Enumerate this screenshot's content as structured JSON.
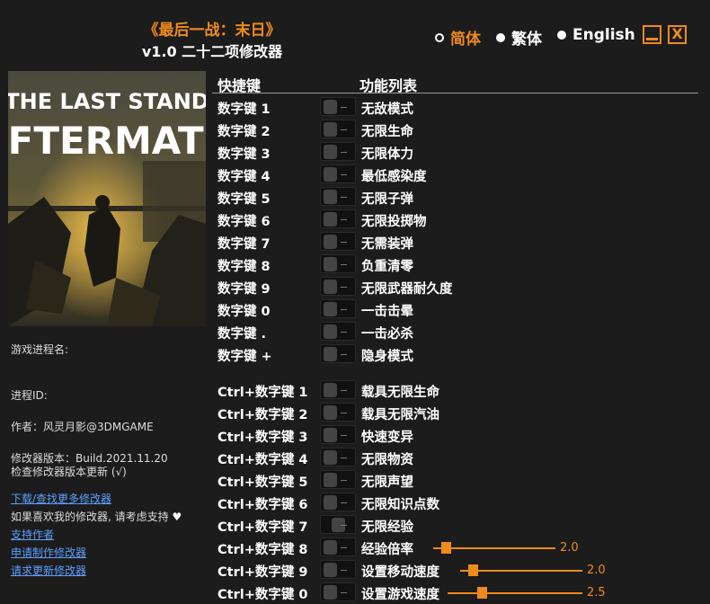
{
  "header": {
    "title": "《最后一战：末日》",
    "subtitle": "v1.0 二十二项修改器"
  },
  "languages": [
    {
      "label": "简体",
      "selected": true
    },
    {
      "label": "繁体",
      "selected": false
    },
    {
      "label": "English",
      "selected": false
    }
  ],
  "window": {
    "minimize_icon": "minimize-icon",
    "close_label": "X"
  },
  "cover": {
    "line1": "THE LAST STAND",
    "line2": "AFTERMATH"
  },
  "info": {
    "process_name": "游戏进程名:",
    "process_id": "进程ID:",
    "author": "作者：风灵月影@3DMGAME",
    "version": "修改器版本：Build.2021.11.20",
    "check_update": "检查修改器版本更新 (√)",
    "download_more": "下载/查找更多修改器",
    "support_text": "如果喜欢我的修改器, 请考虑支持",
    "support_icon": "heart-icon",
    "support_author": "支持作者",
    "request_trainer": "申请制作修改器",
    "request_update": "请求更新修改器"
  },
  "table": {
    "col_hotkey": "快捷键",
    "col_function": "功能列表",
    "rows": [
      {
        "key": "数字键 1",
        "func": "无敌模式"
      },
      {
        "key": "数字键 2",
        "func": "无限生命"
      },
      {
        "key": "数字键 3",
        "func": "无限体力"
      },
      {
        "key": "数字键 4",
        "func": "最低感染度"
      },
      {
        "key": "数字键 5",
        "func": "无限子弹"
      },
      {
        "key": "数字键 6",
        "func": "无限投掷物"
      },
      {
        "key": "数字键 7",
        "func": "无需装弹"
      },
      {
        "key": "数字键 8",
        "func": "负重清零"
      },
      {
        "key": "数字键 9",
        "func": "无限武器耐久度"
      },
      {
        "key": "数字键 0",
        "func": "一击击晕"
      },
      {
        "key": "数字键 .",
        "func": "一击必杀"
      },
      {
        "key": "数字键 +",
        "func": "隐身模式"
      },
      {
        "key": "Ctrl+数字键 1",
        "func": "载具无限生命"
      },
      {
        "key": "Ctrl+数字键 2",
        "func": "载具无限汽油"
      },
      {
        "key": "Ctrl+数字键 3",
        "func": "快速变异"
      },
      {
        "key": "Ctrl+数字键 4",
        "func": "无限物资"
      },
      {
        "key": "Ctrl+数字键 5",
        "func": "无限声望"
      },
      {
        "key": "Ctrl+数字键 6",
        "func": "无限知识点数"
      },
      {
        "key": "Ctrl+数字键 7",
        "func": "无限经验"
      },
      {
        "key": "Ctrl+数字键 8",
        "func": "经验倍率"
      },
      {
        "key": "Ctrl+数字键 9",
        "func": "设置移动速度"
      },
      {
        "key": "Ctrl+数字键 0",
        "func": "设置游戏速度"
      }
    ]
  },
  "sliders": {
    "exp_rate": {
      "value": "2.0",
      "fraction": 0.1
    },
    "move_speed": {
      "value": "2.0",
      "fraction": 0.1
    },
    "game_speed": {
      "value": "2.5",
      "fraction": 0.25
    }
  }
}
